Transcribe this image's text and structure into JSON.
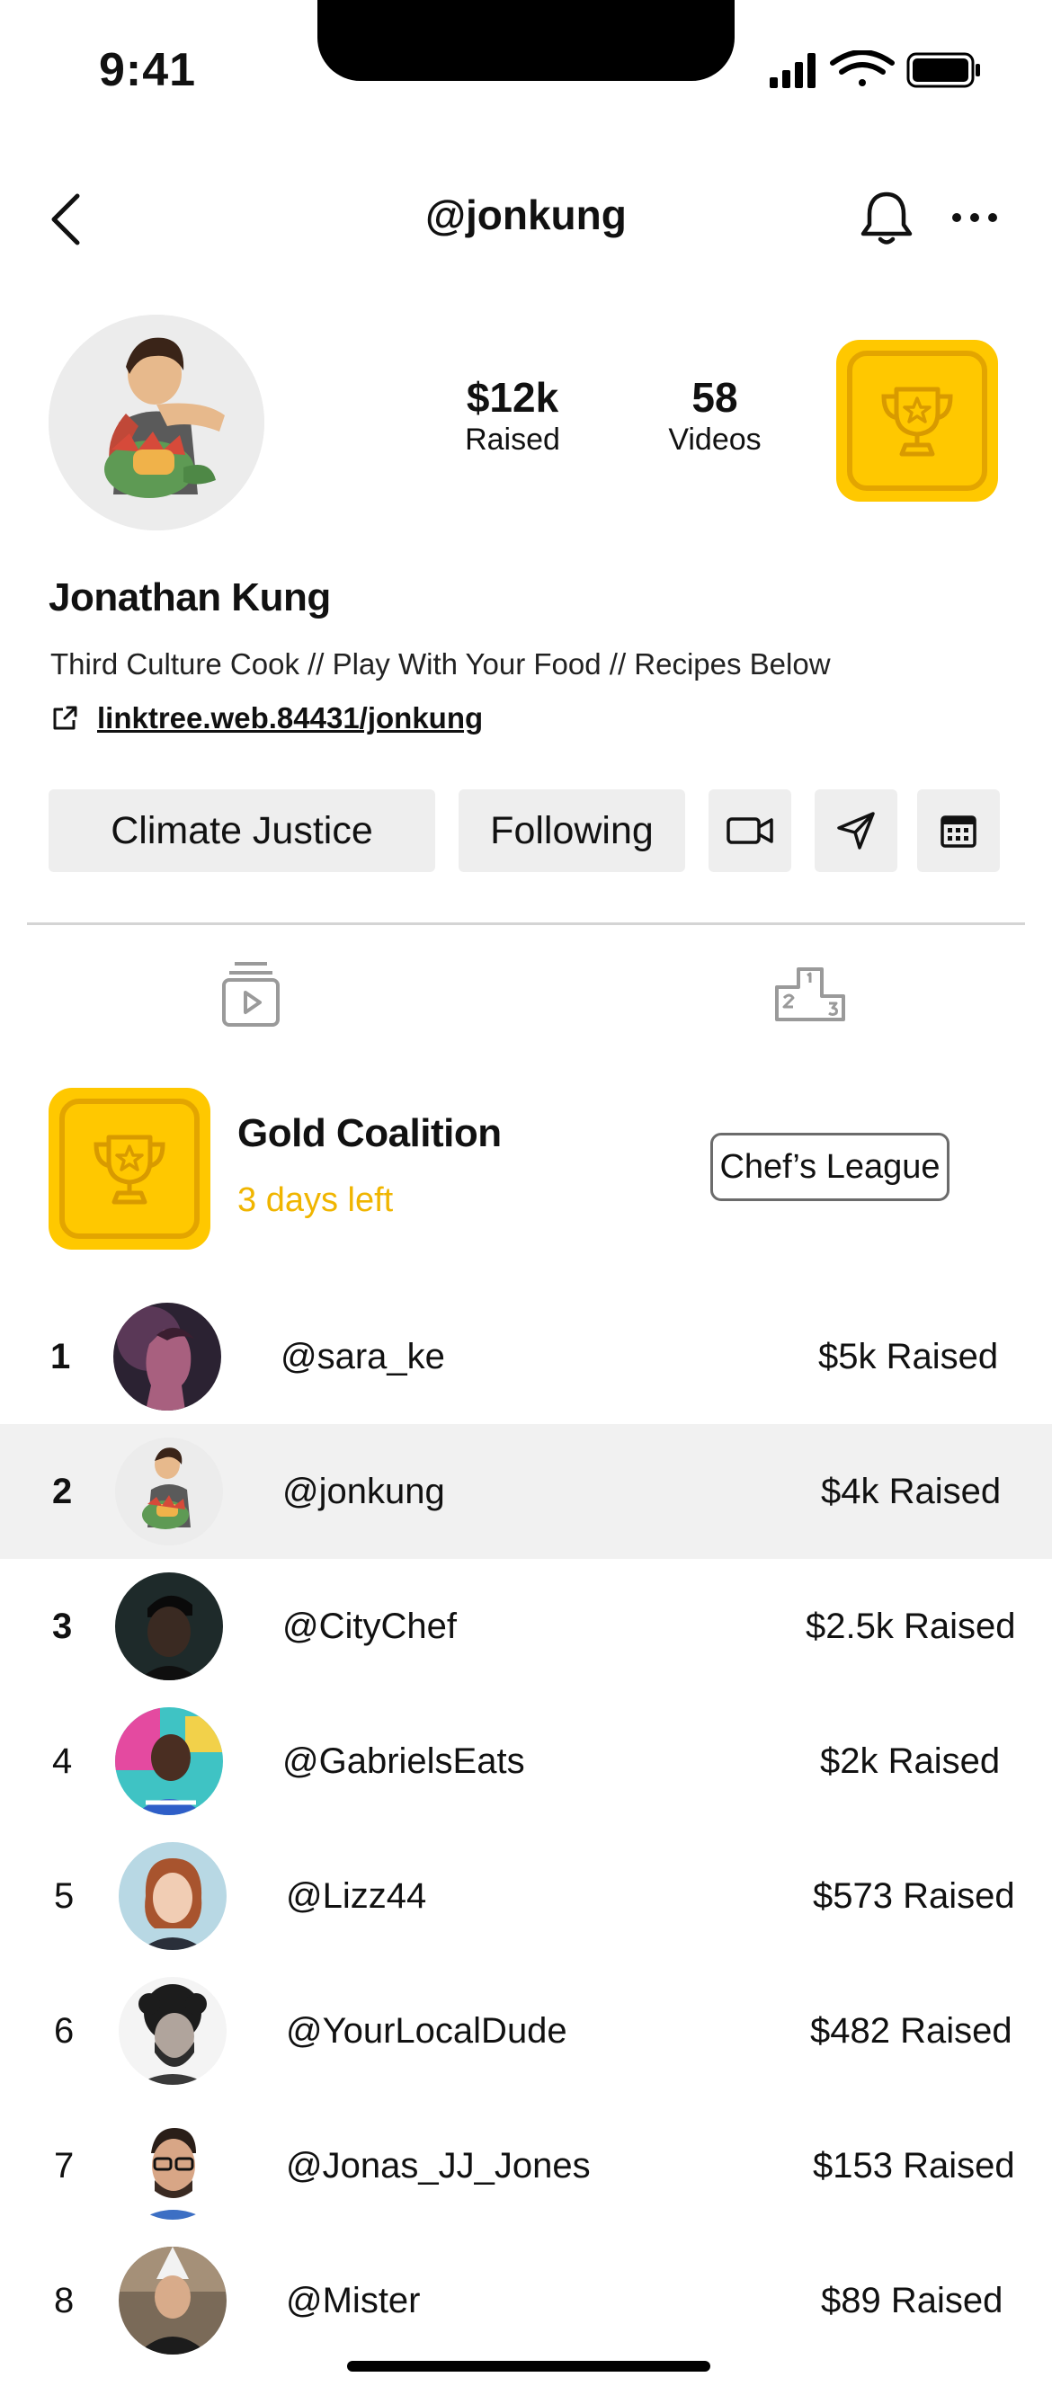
{
  "status_bar": {
    "time": "9:41"
  },
  "header": {
    "handle": "@jonkung"
  },
  "profile": {
    "stats": [
      {
        "value": "$12k",
        "label": "Raised"
      },
      {
        "value": "58",
        "label": "Videos"
      }
    ],
    "name": "Jonathan Kung",
    "bio": "Third Culture Cook // Play With Your Food //  Recipes Below",
    "link": "linktree.web.84431/jonkung"
  },
  "actions": {
    "cause_label": "Climate Justice",
    "follow_label": "Following"
  },
  "tabs": [
    {
      "icon": "video-stack-icon"
    },
    {
      "icon": "podium-icon"
    }
  ],
  "league": {
    "title": "Gold Coalition",
    "time_left": "3 days left",
    "league_button": "Chef’s League"
  },
  "leaderboard": [
    {
      "rank": "1",
      "handle": "@sara_ke",
      "raised": "$5k Raised"
    },
    {
      "rank": "2",
      "handle": "@jonkung",
      "raised": "$4k Raised"
    },
    {
      "rank": "3",
      "handle": "@CityChef",
      "raised": "$2.5k Raised"
    },
    {
      "rank": "4",
      "handle": "@GabrielsEats",
      "raised": "$2k Raised"
    },
    {
      "rank": "5",
      "handle": "@Lizz44",
      "raised": "$573 Raised"
    },
    {
      "rank": "6",
      "handle": "@YourLocalDude",
      "raised": "$482 Raised"
    },
    {
      "rank": "7",
      "handle": "@Jonas_JJ_Jones",
      "raised": "$153 Raised"
    },
    {
      "rank": "8",
      "handle": "@Mister",
      "raised": "$89 Raised"
    }
  ],
  "colors": {
    "gold": "#ffc800",
    "gold_dark": "#e3a500",
    "accent_text": "#f0b500",
    "highlight_row": "#f1f1f1"
  }
}
